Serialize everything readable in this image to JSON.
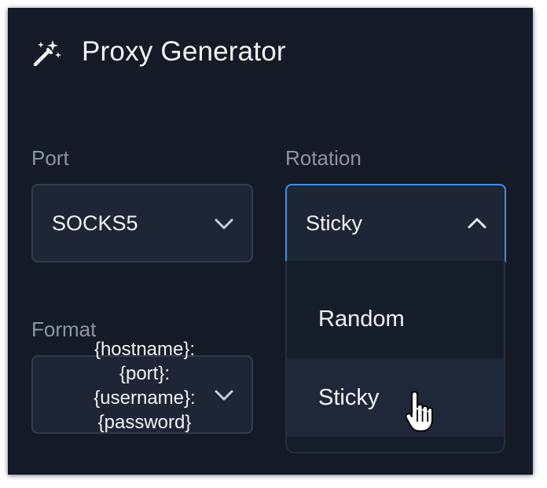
{
  "header": {
    "icon": "magic-wand-icon",
    "title": "Proxy Generator"
  },
  "port": {
    "label": "Port",
    "value": "SOCKS5",
    "icon": "chevron-down-icon"
  },
  "rotation": {
    "label": "Rotation",
    "value": "Sticky",
    "icon": "chevron-up-icon",
    "expanded": true,
    "options": [
      "Random",
      "Sticky"
    ],
    "hovered_option": "Sticky"
  },
  "format": {
    "label": "Format",
    "value_lines": [
      "{hostname}:",
      "{port}:",
      "{username}:",
      "{password}"
    ],
    "icon": "chevron-down-icon"
  },
  "colors": {
    "panel_background": "#141b27",
    "field_background": "#1e2635",
    "focus_border": "#3b8fe6",
    "label_text": "#8b95a6",
    "primary_text": "#f1f3f6"
  },
  "pointer": "hand-pointer-icon"
}
